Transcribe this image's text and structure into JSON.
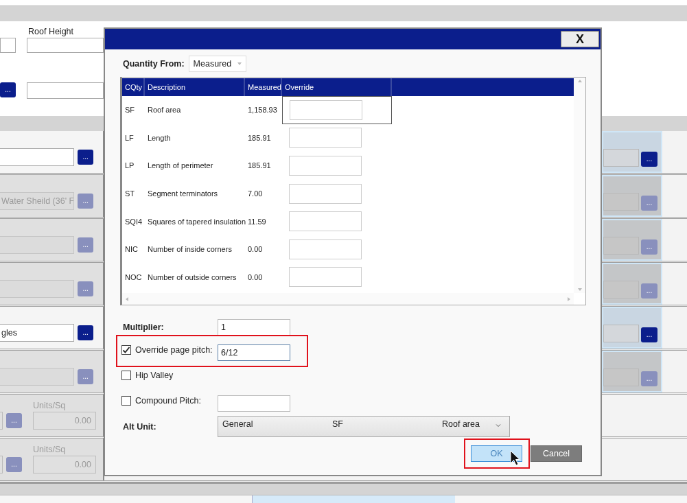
{
  "background": {
    "roof_height_label": "Roof Height",
    "browse_label": "...",
    "rows": [
      {
        "kind": "field",
        "enabled": true,
        "value": ""
      },
      {
        "kind": "field",
        "enabled": false,
        "value": "Water Sheild (36' F"
      },
      {
        "kind": "field",
        "enabled": false,
        "value": ""
      },
      {
        "kind": "field",
        "enabled": false,
        "value": ""
      },
      {
        "kind": "field",
        "enabled": true,
        "value": "gles"
      },
      {
        "kind": "field",
        "enabled": false,
        "value": ""
      },
      {
        "kind": "units",
        "enabled": false,
        "label": "Units/Sq",
        "value": "0.00"
      },
      {
        "kind": "units",
        "enabled": false,
        "label": "Units/Sq",
        "value": "0.00"
      }
    ],
    "right_panels": [
      {
        "enabled": true,
        "browse_label": "..."
      },
      {
        "enabled": false,
        "browse_label": "..."
      },
      {
        "enabled": false,
        "browse_label": "..."
      },
      {
        "enabled": false,
        "browse_label": "..."
      },
      {
        "enabled": true,
        "browse_label": "..."
      },
      {
        "enabled": false,
        "browse_label": "..."
      }
    ]
  },
  "dialog": {
    "close_label": "X",
    "quantity_from": {
      "label": "Quantity From:",
      "value": "Measured"
    },
    "table": {
      "columns": [
        "CQty",
        "Description",
        "Measured",
        "Override"
      ],
      "rows": [
        {
          "cqty": "SF",
          "description": "Roof area",
          "measured": "1,158.93",
          "selected": true
        },
        {
          "cqty": "LF",
          "description": "Length",
          "measured": "185.91",
          "selected": false
        },
        {
          "cqty": "LP",
          "description": "Length of perimeter",
          "measured": "185.91",
          "selected": false
        },
        {
          "cqty": "ST",
          "description": "Segment terminators",
          "measured": "7.00",
          "selected": false
        },
        {
          "cqty": "SQI4",
          "description": "Squares of tapered insulation",
          "measured": "11.59",
          "selected": false
        },
        {
          "cqty": "NIC",
          "description": "Number of inside corners",
          "measured": "0.00",
          "selected": false
        },
        {
          "cqty": "NOC",
          "description": "Number of outside corners",
          "measured": "0.00",
          "selected": false
        }
      ]
    },
    "multiplier": {
      "label": "Multiplier:",
      "value": "1"
    },
    "options": [
      {
        "kind": "field",
        "label": "Override page pitch:",
        "checked": true,
        "value": "6/12",
        "highlighted": true
      },
      {
        "kind": "plain",
        "label": "Hip Valley",
        "checked": false,
        "highlighted": false
      },
      {
        "kind": "field",
        "label": "Compound Pitch:",
        "checked": false,
        "highlighted": false
      }
    ],
    "alt_unit": {
      "label": "Alt Unit:",
      "group": "General",
      "unit": "SF",
      "description": "Roof area"
    },
    "buttons": [
      {
        "label": "OK",
        "kind": "primary",
        "highlighted": true
      },
      {
        "label": "Cancel",
        "kind": "secondary",
        "highlighted": false
      }
    ]
  }
}
